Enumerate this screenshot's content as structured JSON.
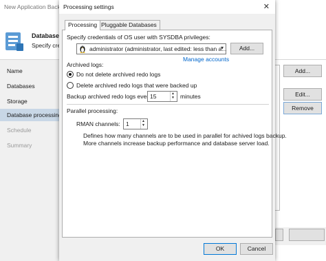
{
  "background_window": {
    "title": "New Application Backup",
    "header_title": "Database p",
    "header_subtitle": "Specify credi",
    "nav_items": [
      "Name",
      "Databases",
      "Storage",
      "Database processing",
      "Schedule",
      "Summary"
    ],
    "active_nav_index": 3,
    "buttons": {
      "add": "Add...",
      "edit": "Edit...",
      "remove": "Remove"
    }
  },
  "dialog": {
    "title": "Processing settings",
    "tabs": [
      "Processing",
      "Pluggable Databases"
    ],
    "active_tab": 0,
    "credentials_label": "Specify credentials of OS user with SYSDBA privileges:",
    "credentials_value": "administrator (administrator, last edited: less than a...",
    "credentials_icon": "linux-penguin-icon",
    "add_button": "Add...",
    "manage_link": "Manage accounts",
    "archived_logs_label": "Archived logs:",
    "radio_options": [
      "Do not delete archived redo logs",
      "Delete archived redo logs that were backed up"
    ],
    "selected_radio": 0,
    "retain_label": "Backup archived redo logs every:",
    "retain_value": "15",
    "retain_unit": "minutes",
    "parallel_label": "Parallel processing:",
    "channels_label": "RMAN channels:",
    "channels_value": "1",
    "description_line1": "Defines how many channels are to be used in parallel for achived logs backup.",
    "description_line2": "More channels increase backup performance and database server load.",
    "ok_button": "OK",
    "cancel_button": "Cancel",
    "close_symbol": "✕"
  },
  "colors": {
    "accent": "#0078d7",
    "link": "#0066cc",
    "nav_active": "#c8d7e6"
  }
}
